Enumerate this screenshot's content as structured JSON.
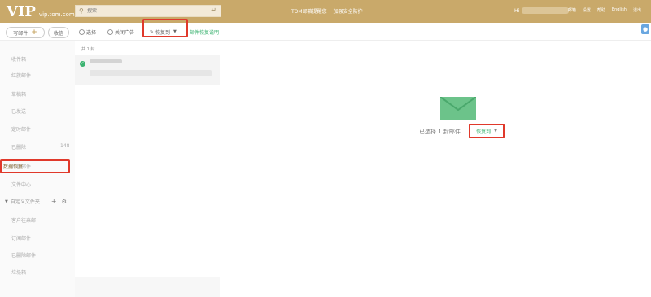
{
  "header": {
    "logo": "VIP",
    "domain": "vip.tom.com",
    "search_placeholder": "搜索",
    "promo_1": "TOM邮箱提醒您",
    "promo_2": "加强安全防护",
    "account_prefix": "Hi",
    "links": [
      "邮箱",
      "设置",
      "帮助",
      "English",
      "退出"
    ]
  },
  "toolbar": {
    "write": "写邮件",
    "receive": "收信",
    "select": "选择",
    "close_ad": "关闭广告",
    "restore_to": "恢复到",
    "restore_help": "邮件恢复说明"
  },
  "sidebar": {
    "folders": [
      {
        "label": "收件箱",
        "count": ""
      },
      {
        "label": "红旗邮件",
        "count": ""
      },
      {
        "label": "草稿箱",
        "count": ""
      },
      {
        "label": "已发送",
        "count": ""
      },
      {
        "label": "定时邮件",
        "count": ""
      },
      {
        "label": "已删除",
        "count": "148"
      },
      {
        "label": "垃圾邮件",
        "count": ""
      },
      {
        "label": "数据恢复",
        "count": ""
      },
      {
        "label": "文件中心",
        "count": ""
      }
    ],
    "custom_title": "自定义文件夹",
    "custom_folders": [
      "客户往来邮",
      "订阅邮件",
      "已删除邮件",
      "垃圾箱"
    ]
  },
  "list": {
    "count_label": "共 1 封"
  },
  "main": {
    "selected_text": "已选择 1 封邮件",
    "restore_button": "恢复到"
  },
  "colors": {
    "header": "#c9a96a",
    "accent_green": "#3cb371",
    "highlight_red": "#e0392b"
  }
}
